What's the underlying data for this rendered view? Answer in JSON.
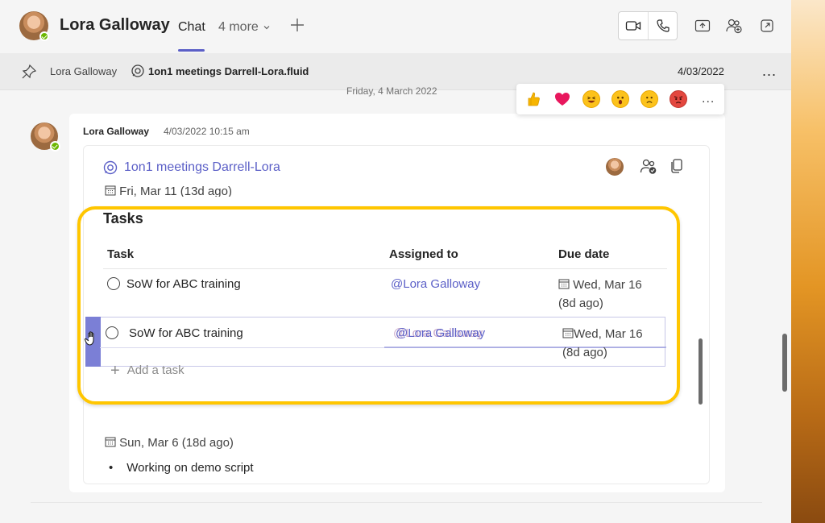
{
  "header": {
    "title": "Lora Galloway",
    "tab_chat": "Chat",
    "tab_more": "4 more"
  },
  "subheader": {
    "pinned_name": "Lora Galloway",
    "file_name": "1on1 meetings Darrell-Lora.fluid",
    "date": "4/03/2022",
    "more": "..."
  },
  "date_divider": "Friday, 4 March 2022",
  "reactions": {
    "items": [
      "like",
      "heart",
      "laugh",
      "surprised",
      "sad",
      "angry"
    ],
    "more": "..."
  },
  "message": {
    "author": "Lora Galloway",
    "timestamp": "4/03/2022 10:15 am"
  },
  "loop": {
    "title": "1on1 meetings Darrell-Lora",
    "previous_date": "Fri, Mar 11 (13d ago)",
    "tasks_heading": "Tasks",
    "columns": [
      "Task",
      "Assigned to",
      "Due date"
    ],
    "rows": [
      {
        "task": "SoW for ABC training",
        "assigned": "@Lora Galloway",
        "due_line1": "Wed, Mar 16",
        "due_line2": "(8d ago)"
      },
      {
        "task": "SoW for ABC training",
        "assigned": "@Lora Galloway",
        "due_line1": "Wed, Mar 16",
        "due_line2": "(8d ago)"
      }
    ],
    "add_task": "Add a task",
    "next_date": "Sun, Mar 6 (18d ago)",
    "bullets": [
      "Working on demo script"
    ]
  },
  "colors": {
    "accent": "#5b5fc7",
    "highlight": "#ffc600",
    "presence": "#6bb700"
  }
}
